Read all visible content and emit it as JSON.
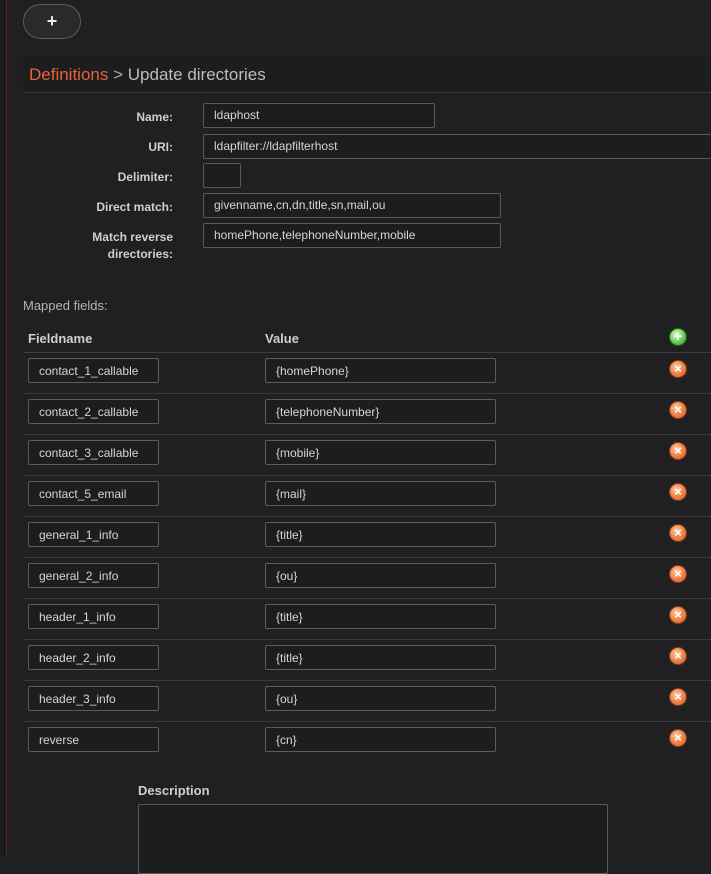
{
  "toolbar": {
    "add_icon": "plus-icon",
    "add_glyph": "+"
  },
  "breadcrumb": {
    "parent": "Definitions",
    "separator": ">",
    "current": "Update directories"
  },
  "form": {
    "name_label": "Name:",
    "name_value": "ldaphost",
    "uri_label": "URI:",
    "uri_value": "ldapfilter://ldapfilterhost",
    "delimiter_label": "Delimiter:",
    "delimiter_value": "",
    "direct_match_label": "Direct match:",
    "direct_match_value": "givenname,cn,dn,title,sn,mail,ou",
    "match_reverse_label": "Match reverse directories:",
    "match_reverse_value": "homePhone,telephoneNumber,mobile"
  },
  "mapped": {
    "section_label": "Mapped fields:",
    "col_fieldname": "Fieldname",
    "col_value": "Value",
    "add_icon": "plus-circle-icon",
    "add_glyph": "+",
    "delete_icon": "x-circle-icon",
    "delete_glyph": "×",
    "rows": [
      {
        "field": "contact_1_callable",
        "value": "{homePhone}"
      },
      {
        "field": "contact_2_callable",
        "value": "{telephoneNumber}"
      },
      {
        "field": "contact_3_callable",
        "value": "{mobile}"
      },
      {
        "field": "contact_5_email",
        "value": "{mail}"
      },
      {
        "field": "general_1_info",
        "value": "{title}"
      },
      {
        "field": "general_2_info",
        "value": "{ou}"
      },
      {
        "field": "header_1_info",
        "value": "{title}"
      },
      {
        "field": "header_2_info",
        "value": "{title}"
      },
      {
        "field": "header_3_info",
        "value": "{ou}"
      },
      {
        "field": "reverse",
        "value": "{cn}"
      }
    ]
  },
  "description": {
    "label": "Description",
    "value": ""
  },
  "colors": {
    "accent": "#e8623a",
    "background": "#202022",
    "add": "#3fae2e",
    "delete": "#e0672f"
  }
}
